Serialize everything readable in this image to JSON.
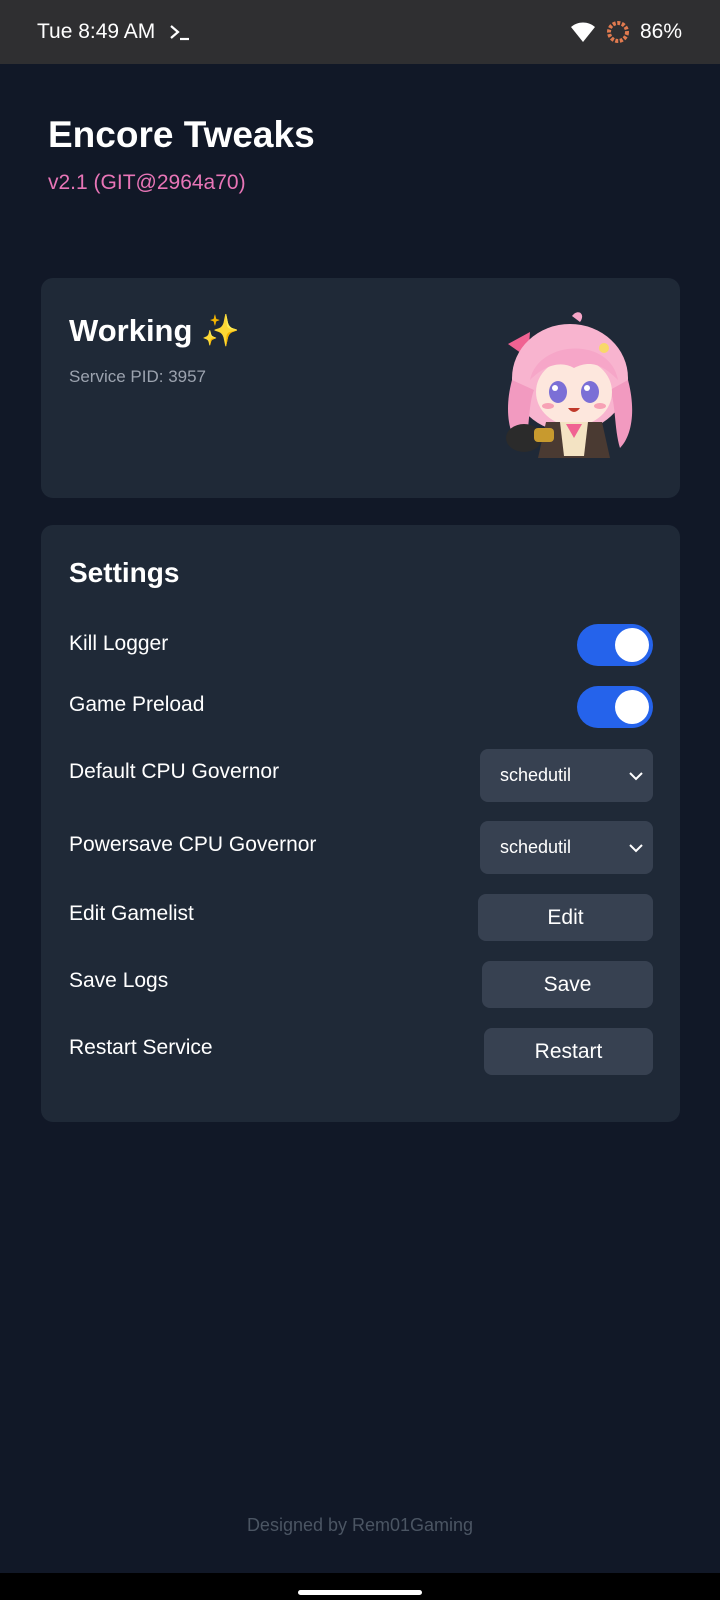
{
  "status_bar": {
    "time": "Tue 8:49 AM",
    "battery": "86%",
    "icons": [
      "terminal-icon",
      "wifi-icon",
      "battery-ring-icon"
    ]
  },
  "header": {
    "title": "Encore Tweaks",
    "version": "v2.1 (GIT@2964a70)"
  },
  "status_card": {
    "title": "Working",
    "emoji": "✨",
    "pid_text": "Service PID: 3957"
  },
  "settings": {
    "title": "Settings",
    "kill_logger": {
      "label": "Kill Logger",
      "enabled": true
    },
    "game_preload": {
      "label": "Game Preload",
      "enabled": true
    },
    "default_governor": {
      "label": "Default CPU Governor",
      "value": "schedutil"
    },
    "powersave_governor": {
      "label": "Powersave CPU Governor",
      "value": "schedutil"
    },
    "edit_gamelist": {
      "label": "Edit Gamelist",
      "button": "Edit"
    },
    "save_logs": {
      "label": "Save Logs",
      "button": "Save"
    },
    "restart_service": {
      "label": "Restart Service",
      "button": "Restart"
    }
  },
  "footer": {
    "credit": "Designed by Rem01Gaming"
  },
  "colors": {
    "background": "#111827",
    "card": "#1f2937",
    "accent_pink": "#e875b7",
    "toggle_on": "#2563eb",
    "control_bg": "#374151"
  }
}
